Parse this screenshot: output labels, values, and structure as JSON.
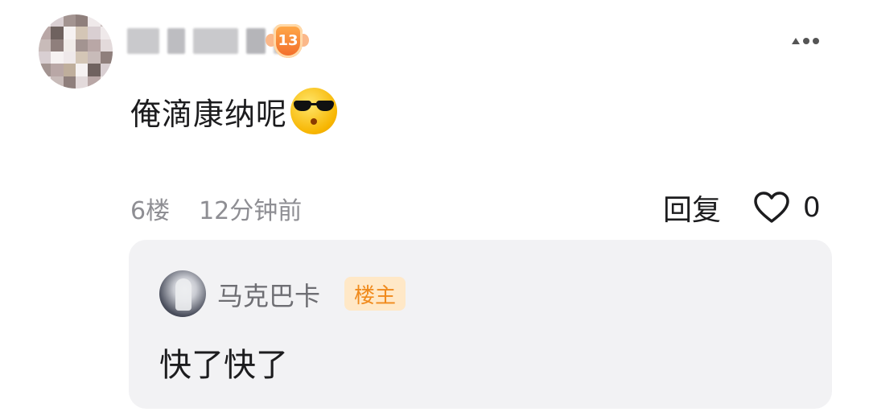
{
  "comment": {
    "author": {
      "avatar_icon": "blurred-avatar-icon",
      "level": "13",
      "level_badge_color": "#f26b2a"
    },
    "text": "俺滴康纳呢",
    "emoji_icon": "cool-sunglasses-emoji-icon",
    "floor": "6楼",
    "time": "12分钟前",
    "reply_label": "回复",
    "like_count": "0",
    "more_icon": "more-options-icon"
  },
  "sub_reply": {
    "author_name": "马克巴卡",
    "author_tag": "楼主",
    "tag_color": "#f08a1c",
    "tag_bg": "#ffe8c7",
    "text": "快了快了"
  }
}
